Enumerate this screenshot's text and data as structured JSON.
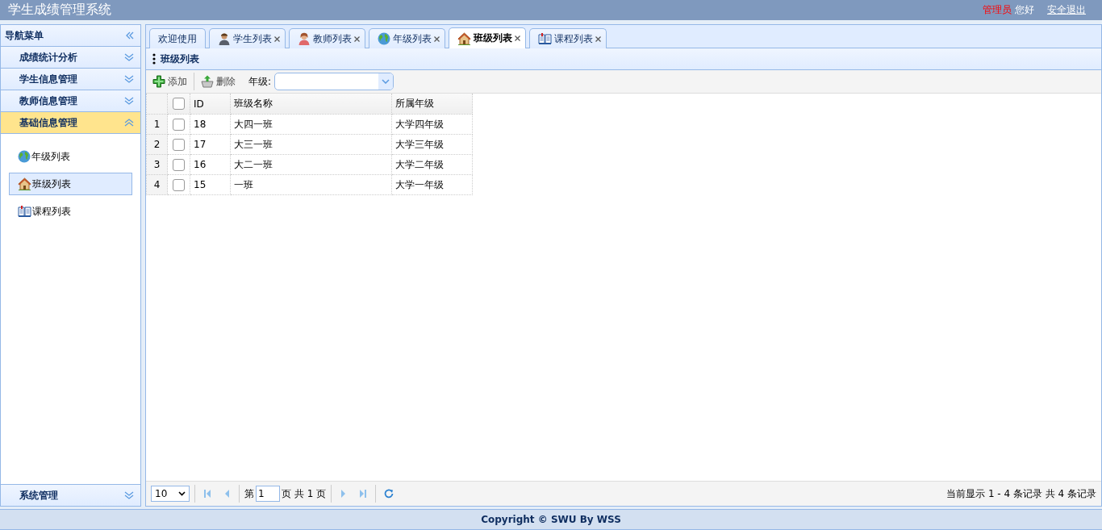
{
  "header": {
    "title": "学生成绩管理系统",
    "user_role": "管理员",
    "greeting": "您好",
    "logout": "安全退出"
  },
  "sidebar": {
    "title": "导航菜单",
    "sections": [
      {
        "label": "成绩统计分析",
        "expanded": false
      },
      {
        "label": "学生信息管理",
        "expanded": false
      },
      {
        "label": "教师信息管理",
        "expanded": false
      },
      {
        "label": "基础信息管理",
        "expanded": true,
        "items": [
          {
            "label": "年级列表",
            "selected": false
          },
          {
            "label": "班级列表",
            "selected": true
          },
          {
            "label": "课程列表",
            "selected": false
          }
        ]
      }
    ],
    "bottom_section": {
      "label": "系统管理",
      "expanded": false
    }
  },
  "tabs": [
    {
      "label": "欢迎使用",
      "closable": false,
      "selected": false
    },
    {
      "label": "学生列表",
      "closable": true,
      "selected": false
    },
    {
      "label": "教师列表",
      "closable": true,
      "selected": false
    },
    {
      "label": "年级列表",
      "closable": true,
      "selected": false
    },
    {
      "label": "班级列表",
      "closable": true,
      "selected": true
    },
    {
      "label": "课程列表",
      "closable": true,
      "selected": false
    }
  ],
  "panel": {
    "title": "班级列表"
  },
  "toolbar": {
    "buttons": [
      {
        "label": "添加",
        "kind": "add"
      },
      {
        "label": "删除",
        "kind": "delete"
      }
    ],
    "filter_label": "年级:"
  },
  "table": {
    "select_all_checked": false,
    "columns": [
      "ID",
      "班级名称",
      "所属年级"
    ],
    "rows": [
      {
        "number": "1",
        "checked": false,
        "cells": [
          "18",
          "大四一班",
          "大学四年级"
        ]
      },
      {
        "number": "2",
        "checked": false,
        "cells": [
          "17",
          "大三一班",
          "大学三年级"
        ]
      },
      {
        "number": "3",
        "checked": false,
        "cells": [
          "16",
          "大二一班",
          "大学二年级"
        ]
      },
      {
        "number": "4",
        "checked": false,
        "cells": [
          "15",
          "一班",
          "大学一年级"
        ]
      }
    ]
  },
  "pager": {
    "page_size": "10",
    "page_prefix": "第",
    "page": "1",
    "page_suffix": "页 共 1 页",
    "info": "当前显示 1 - 4 条记录 共 4 条记录"
  },
  "footer": {
    "text": "Copyright © SWU By WSS"
  }
}
